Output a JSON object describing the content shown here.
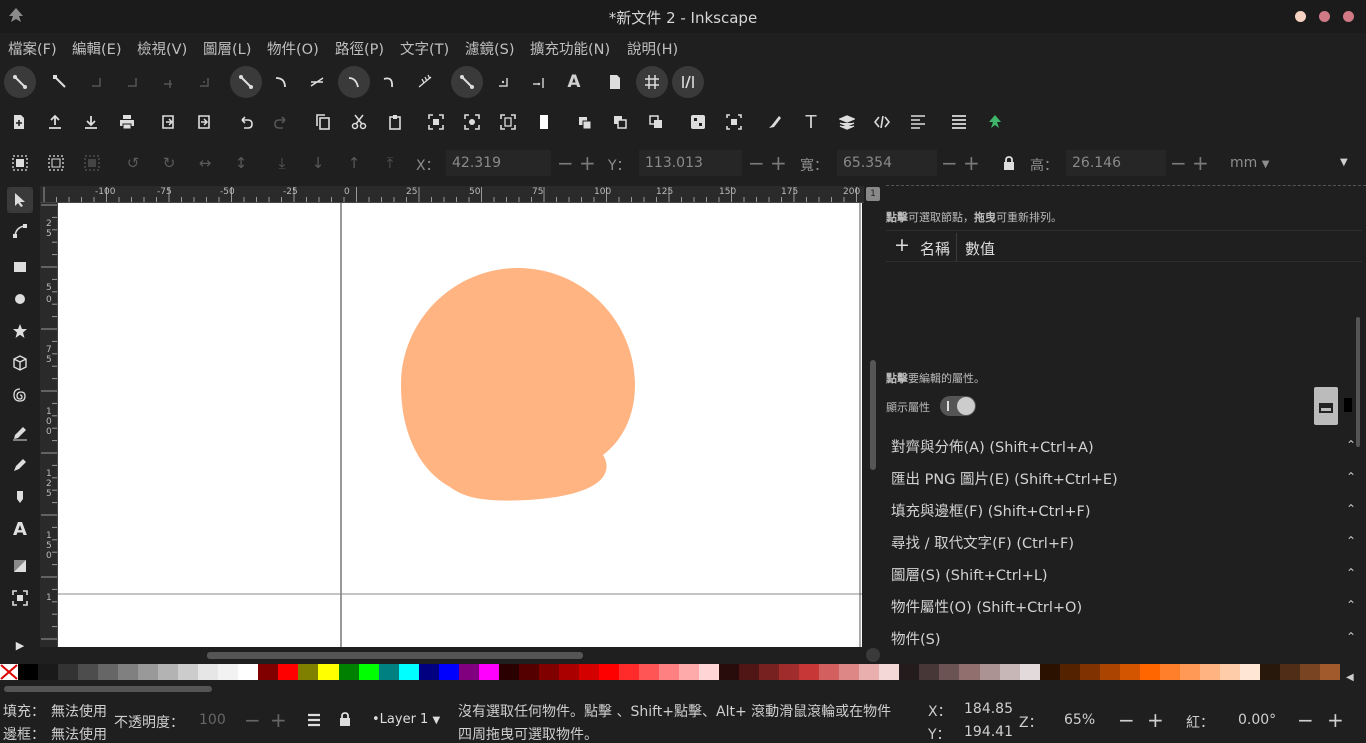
{
  "window": {
    "title": "*新文件 2 - Inkscape",
    "buttons": [
      "minimize",
      "maximize",
      "close"
    ],
    "button_colors": [
      "#f6d2c2",
      "#d07a86",
      "#d07a86"
    ]
  },
  "menu": [
    "檔案(F)",
    "編輯(E)",
    "檢視(V)",
    "圖層(L)",
    "物件(O)",
    "路徑(P)",
    "文字(T)",
    "濾鏡(S)",
    "擴充功能(N)",
    "說明(H)"
  ],
  "tool_controls": {
    "x_label": "X：",
    "x_value": "42.319",
    "y_label": "Y：",
    "y_value": "113.013",
    "w_label": "寬：",
    "w_value": "65.354",
    "h_label": "高：",
    "h_value": "26.146",
    "unit": "mm",
    "minus": "−",
    "plus": "+"
  },
  "ruler_top": [
    "-100",
    "-75",
    "-50",
    "-25",
    "0",
    "25",
    "50",
    "75",
    "100",
    "125",
    "150",
    "175",
    "200"
  ],
  "ruler_left": [
    "2",
    "5",
    "5",
    "0",
    "7",
    "5",
    "1",
    "0",
    "0",
    "1",
    "2",
    "5",
    "1",
    "5",
    "0",
    "1"
  ],
  "canvas": {
    "shape_color": "#ffb482",
    "page_color": "#ffffff"
  },
  "panel": {
    "hint_nodes": "點擊可選取節點，拖曳可重新排列。",
    "hint_nodes_bold1": "點擊",
    "hint_nodes_mid": "可選取節點，",
    "hint_nodes_bold2": "拖曳",
    "hint_nodes_end": "可重新排列。",
    "add": "+",
    "col_name": "名稱",
    "col_value": "數值",
    "hint_attr_bold": "點擊",
    "hint_attr_end": "要編輯的屬性。",
    "show_attr": "顯示屬性",
    "docked": [
      "對齊與分佈(A) (Shift+Ctrl+A)",
      "匯出 PNG 圖片(E) (Shift+Ctrl+E)",
      "填充與邊框(F) (Shift+Ctrl+F)",
      "尋找 / 取代文字(F) (Ctrl+F)",
      "圖層(S) (Shift+Ctrl+L)",
      "物件屬性(O) (Shift+Ctrl+O)",
      "物件(S)"
    ],
    "chevron": "⌃"
  },
  "status": {
    "fill_label": "填充：",
    "fill_value": "無法使用",
    "stroke_label": "邊框：",
    "stroke_value": "無法使用",
    "opacity_label": "不透明度：",
    "opacity_value": "100",
    "layer": "•Layer 1",
    "message": "沒有選取任何物件。點擊、Shift+點擊、Alt+ 滾動滑鼠滾輪或在物件四周拖曳可選取物件。",
    "message_line1": "沒有選取任何物件。點擊 、Shift+點擊、Alt+ 滾動滑鼠滾輪或在物件",
    "message_line2": "四周拖曳可選取物件。",
    "x_label": "X：",
    "x_value": "184.85",
    "y_label": "Y：",
    "y_value": "194.41",
    "zoom_label": "Z：",
    "zoom_value": "65%",
    "rotate_label": "紅：",
    "rotate_value": "0.00°",
    "minus": "−",
    "plus": "+"
  },
  "palette_colors": [
    "#000000",
    "#1a1a1a",
    "#333333",
    "#4d4d4d",
    "#666666",
    "#808080",
    "#999999",
    "#b3b3b3",
    "#cccccc",
    "#e6e6e6",
    "#f2f2f2",
    "#ffffff",
    "#800000",
    "#ff0000",
    "#808000",
    "#ffff00",
    "#008000",
    "#00ff00",
    "#008080",
    "#00ffff",
    "#000080",
    "#0000ff",
    "#800080",
    "#ff00ff",
    "#2b0000",
    "#550000",
    "#800000",
    "#aa0000",
    "#d40000",
    "#ff0000",
    "#ff2a2a",
    "#ff5555",
    "#ff8080",
    "#ffaaaa",
    "#ffd5d5",
    "#280b0b",
    "#501616",
    "#782121",
    "#a02c2c",
    "#c83737",
    "#d35f5f",
    "#de8787",
    "#e9afaf",
    "#f4d7d7",
    "#241c1c",
    "#483737",
    "#6c5353",
    "#916f6f",
    "#ac9393",
    "#c8b7b7",
    "#e3dbdb",
    "#2b1100",
    "#552200",
    "#803300",
    "#aa4400",
    "#d45500",
    "#ff6600",
    "#ff7f2a",
    "#ff9955",
    "#ffb380",
    "#ffccaa",
    "#ffe6d5",
    "#28170b",
    "#502d16",
    "#784421",
    "#a05a2c"
  ]
}
